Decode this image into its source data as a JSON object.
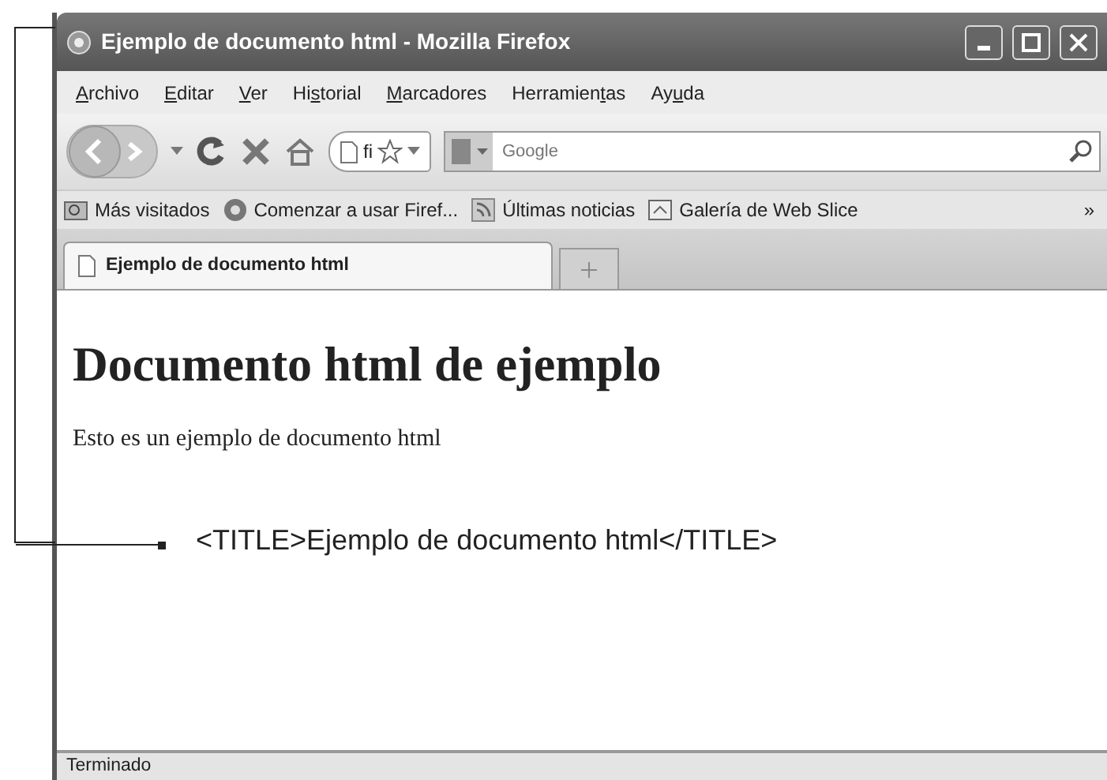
{
  "window": {
    "title": "Ejemplo de documento html - Mozilla Firefox"
  },
  "menu": [
    {
      "key": "A",
      "post": "rchivo"
    },
    {
      "key": "E",
      "post": "ditar"
    },
    {
      "key": "V",
      "post": "er"
    },
    {
      "pre": "Hi",
      "key": "s",
      "post": "torial"
    },
    {
      "key": "M",
      "post": "arcadores"
    },
    {
      "pre": "Herramien",
      "key": "t",
      "post": "as"
    },
    {
      "pre": "Ay",
      "key": "u",
      "post": "da"
    }
  ],
  "navigation": {
    "url": "fi",
    "search_placeholder": "Google"
  },
  "bookmarks": [
    {
      "label": "Más visitados",
      "kind": "folder"
    },
    {
      "label": "Comenzar a usar Firef...",
      "kind": "page"
    },
    {
      "label": "Últimas noticias",
      "kind": "feed"
    },
    {
      "label": "Galería de Web Slice",
      "kind": "slice"
    }
  ],
  "bookmarks_overflow": "»",
  "tabs": [
    {
      "label": "Ejemplo de documento html",
      "selected": true
    }
  ],
  "content": {
    "heading": "Documento html de ejemplo",
    "paragraph": "Esto es un ejemplo de documento html"
  },
  "status_bar": "Terminado",
  "callout": {
    "text": "<TITLE>Ejemplo de documento html</TITLE>"
  }
}
